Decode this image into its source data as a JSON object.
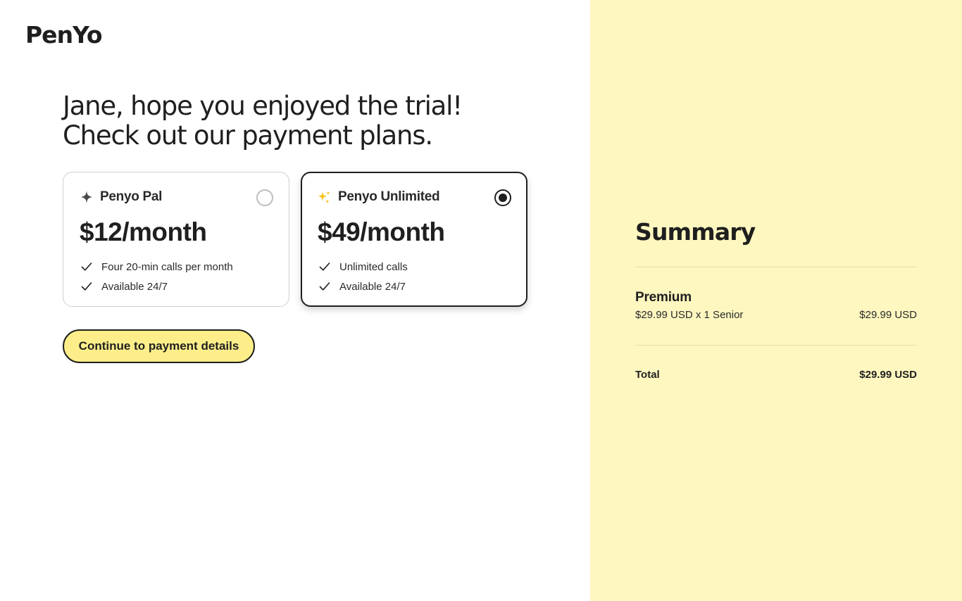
{
  "brand": {
    "logo_text": "PenYo"
  },
  "headline": "Jane, hope you enjoyed the trial! Check out our payment plans.",
  "plans": [
    {
      "name": "Penyo Pal",
      "icon": "sparkle-icon",
      "price": "$12/month",
      "selected": false,
      "features": [
        "Four 20-min calls per month",
        "Available 24/7"
      ]
    },
    {
      "name": "Penyo Unlimited",
      "icon": "sparkles-icon",
      "price": "$49/month",
      "selected": true,
      "features": [
        "Unlimited calls",
        "Available 24/7"
      ]
    }
  ],
  "cta": {
    "label": "Continue to payment details"
  },
  "summary": {
    "title": "Summary",
    "item_name": "Premium",
    "item_desc": "$29.99 USD x 1 Senior",
    "item_price": "$29.99 USD",
    "total_label": "Total",
    "total_value": "$29.99 USD"
  },
  "colors": {
    "accent_yellow": "#fdee8a",
    "summary_bg": "#fef7c0",
    "sparkle_gold": "#f5c518",
    "text": "#1f1f1f"
  }
}
